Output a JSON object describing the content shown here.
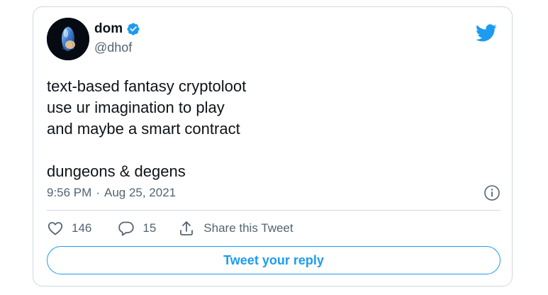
{
  "author": {
    "name": "dom",
    "handle": "@dhof",
    "verified": true
  },
  "tweet": {
    "lines": [
      "text-based fantasy cryptoloot",
      "use ur imagination to play",
      "and maybe a smart contract",
      "",
      "dungeons & degens"
    ],
    "time": "9:56 PM",
    "separator": "·",
    "date": "Aug 25, 2021"
  },
  "actions": {
    "likes": "146",
    "replies": "15",
    "share_label": "Share this Tweet"
  },
  "reply_button_label": "Tweet your reply",
  "icons": {
    "logo": "twitter-bird-icon",
    "verified": "verified-badge-icon",
    "info": "info-icon",
    "like": "heart-icon",
    "reply": "reply-bubble-icon",
    "share": "share-icon"
  },
  "colors": {
    "accent": "#1d9bf0",
    "text": "#0f1419",
    "secondary_text": "#536471",
    "border": "#cfd9de"
  }
}
